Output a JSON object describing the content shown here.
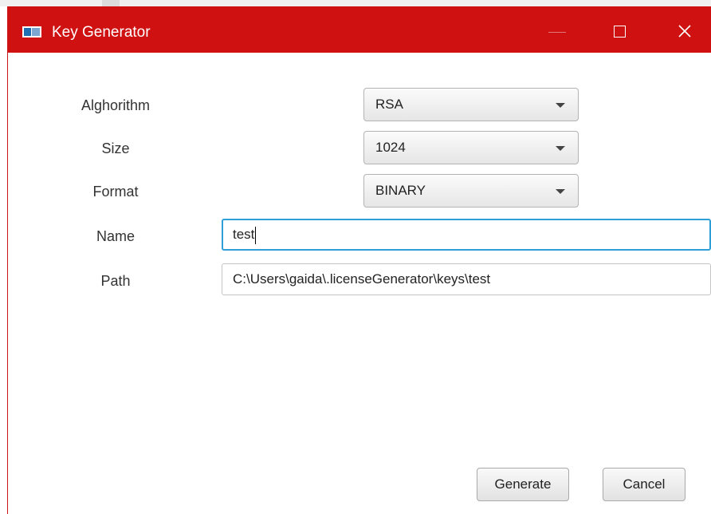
{
  "window": {
    "title": "Key Generator",
    "accent_color": "#cf1111",
    "controls": {
      "minimize": "minimize-icon",
      "maximize": "maximize-icon",
      "close": "close-icon"
    }
  },
  "form": {
    "algorithm": {
      "label": "Alghorithm",
      "value": "RSA"
    },
    "size": {
      "label": "Size",
      "value": "1024"
    },
    "format": {
      "label": "Format",
      "value": "BINARY"
    },
    "name": {
      "label": "Name",
      "value": "test"
    },
    "path": {
      "label": "Path",
      "value": "C:\\Users\\gaida\\.licenseGenerator\\keys\\test"
    }
  },
  "actions": {
    "generate": "Generate",
    "cancel": "Cancel"
  }
}
